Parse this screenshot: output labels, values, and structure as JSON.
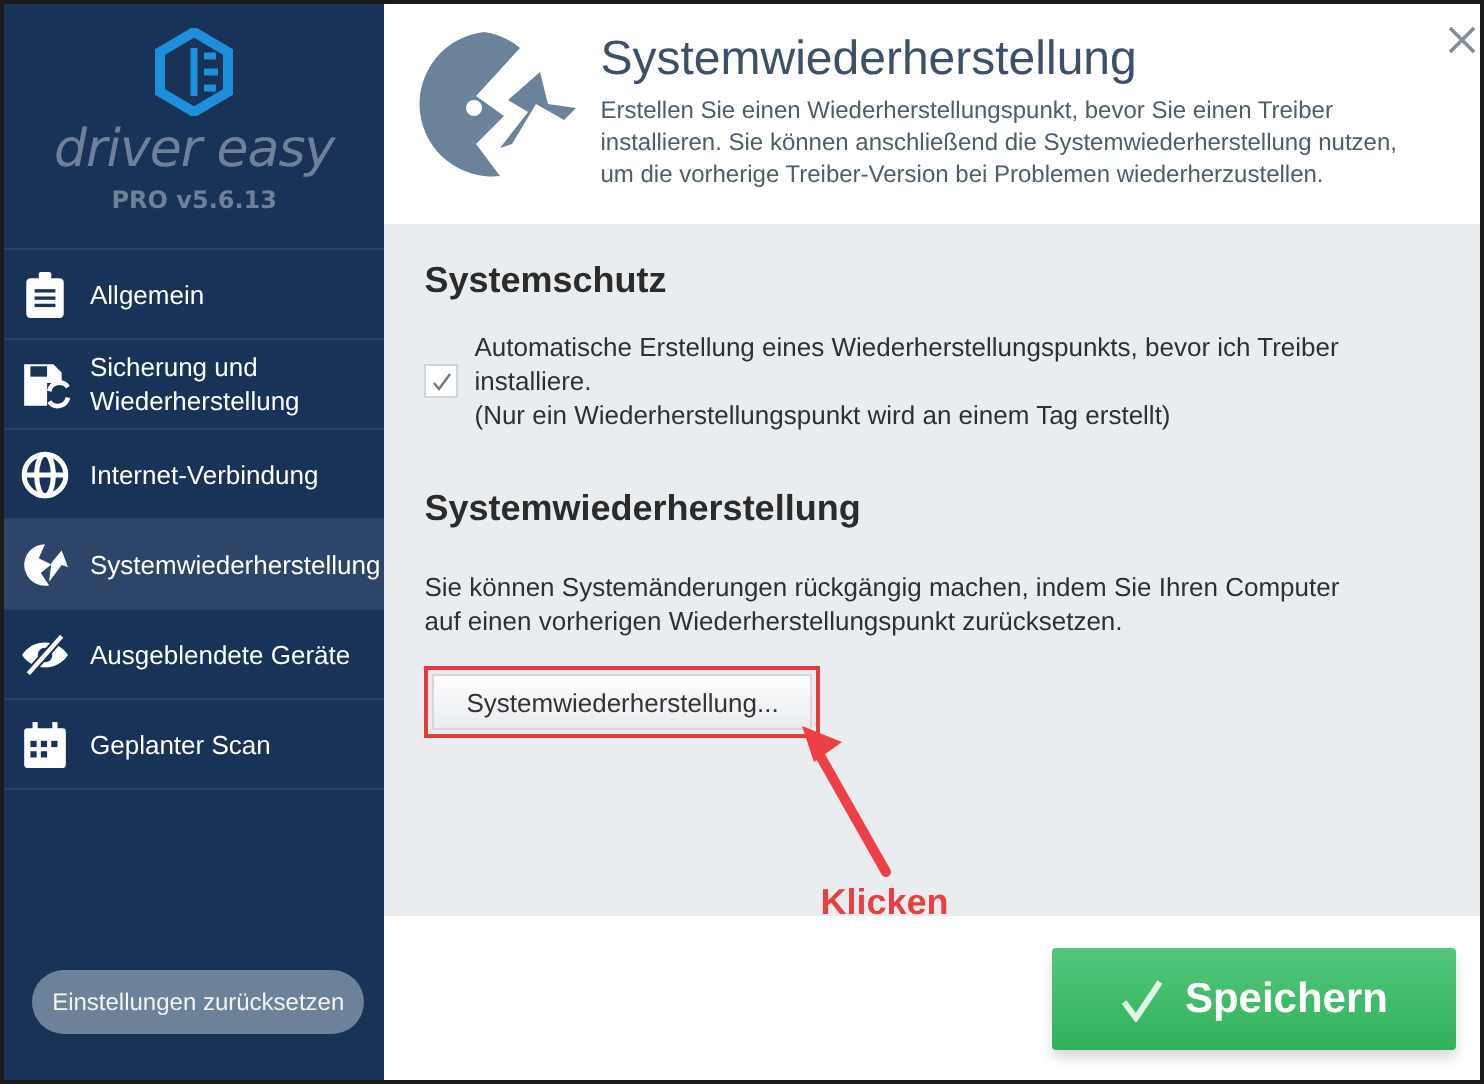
{
  "brand": {
    "name": "driver easy",
    "edition": "PRO v5.6.13"
  },
  "sidebar": {
    "items": [
      {
        "label": "Allgemein",
        "selected": false
      },
      {
        "label": "Sicherung und Wiederherstellung",
        "selected": false
      },
      {
        "label": "Internet-Verbindung",
        "selected": false
      },
      {
        "label": "Systemwiederherstellung",
        "selected": true
      },
      {
        "label": "Ausgeblendete Geräte",
        "selected": false
      },
      {
        "label": "Geplanter Scan",
        "selected": false
      }
    ],
    "reset_button": "Einstellungen zurücksetzen"
  },
  "header": {
    "title": "Systemwiederherstellung",
    "description": "Erstellen Sie einen Wiederherstellungspunkt, bevor Sie einen Treiber installieren. Sie können anschließend die Systemwiederherstellung nutzen, um die vorherige Treiber-Version bei Problemen wiederherzustellen."
  },
  "system_protection": {
    "heading": "Systemschutz",
    "checkbox": {
      "label": "Automatische Erstellung eines Wiederherstellungspunkts, bevor ich Treiber installiere.",
      "note": "(Nur ein Wiederherstellungspunkt wird an einem Tag erstellt)",
      "checked": true
    }
  },
  "system_restore": {
    "heading": "Systemwiederherstellung",
    "text": "Sie können Systemänderungen rückgängig machen, indem Sie Ihren Computer auf einen vorherigen Wiederherstellungspunkt zurücksetzen.",
    "button": "Systemwiederherstellung...",
    "highlighted": true
  },
  "annotation": {
    "label": "Klicken"
  },
  "save_button": "Speichern"
}
